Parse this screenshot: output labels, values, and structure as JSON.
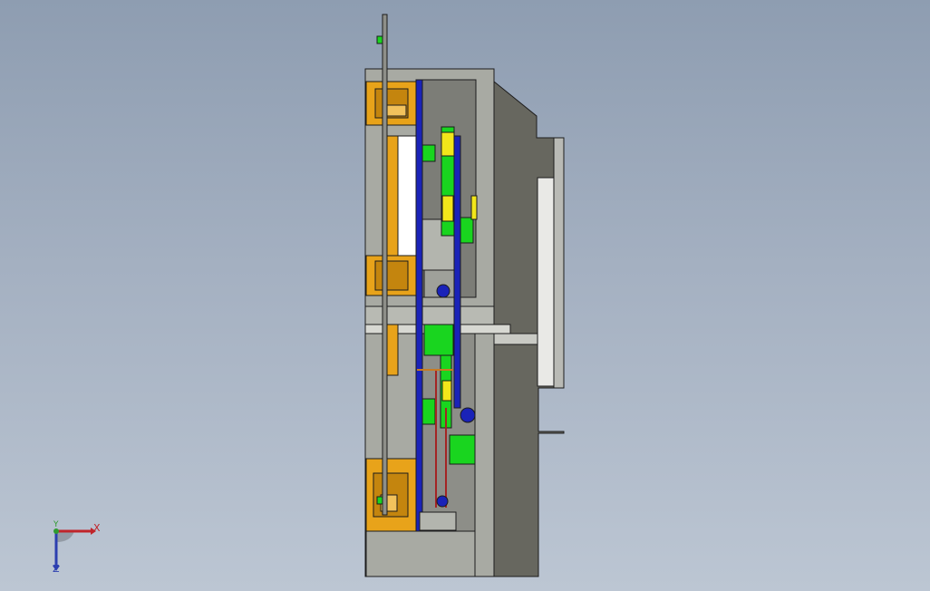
{
  "viewport": {
    "background_top": "#8e9db1",
    "background_bottom": "#bcc6d3"
  },
  "model": {
    "part_colors": {
      "frame": "#a8aaa3",
      "dark_body": "#67675f",
      "orange_block": "#e8a31a",
      "yellow_part": "#f2e61a",
      "green_part": "#19d51f",
      "blue_rail": "#1a23b8",
      "red_wire": "#a42424"
    }
  },
  "triad": {
    "x_label": "X",
    "y_label": "Y",
    "z_label": "Z",
    "x_color": "#c0242a",
    "y_color": "#2f9a2f",
    "z_color": "#2c3fb0"
  }
}
